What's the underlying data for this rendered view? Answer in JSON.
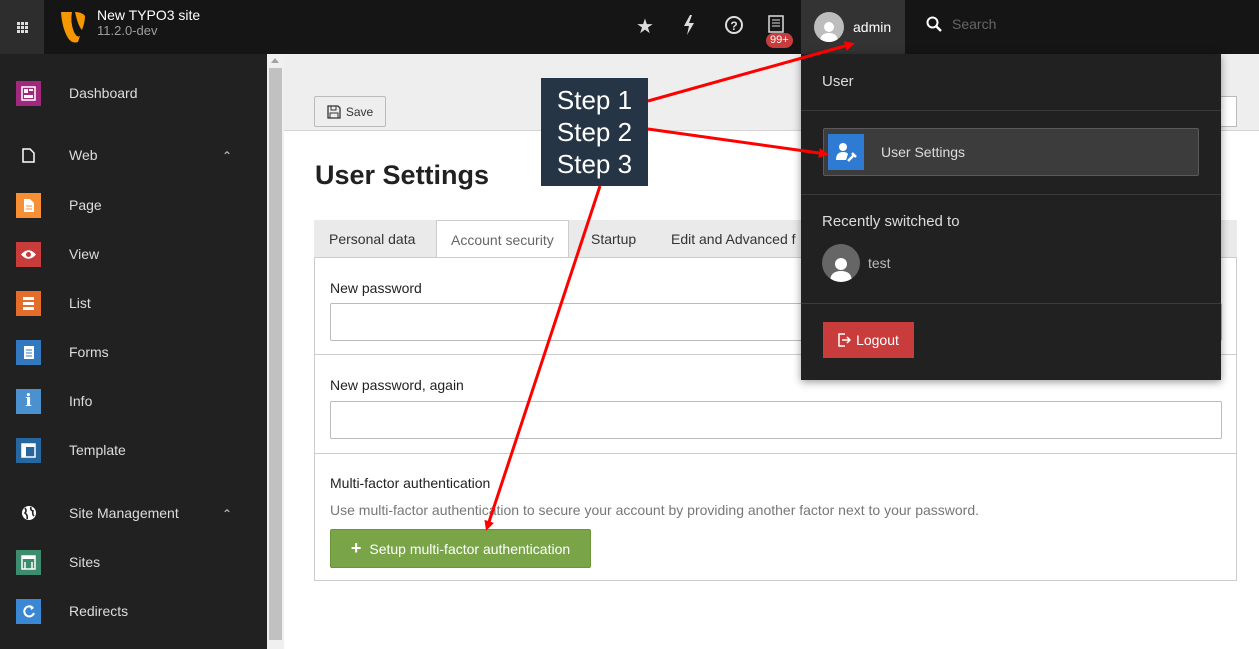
{
  "topbar": {
    "site_name": "New TYPO3 site",
    "version": "11.2.0-dev",
    "notification_badge": "99+",
    "username": "admin",
    "search_placeholder": "Search",
    "icons": [
      "apps-grid-icon",
      "typo3-logo",
      "star-icon",
      "flash-icon",
      "help-icon",
      "system-info-icon",
      "user-avatar-icon",
      "search-icon"
    ]
  },
  "sidebar": {
    "items": [
      {
        "label": "Dashboard",
        "icon": "dashboard-icon",
        "color": "#a0287d"
      },
      {
        "label": "Web",
        "icon": "page-outline-icon",
        "group": true
      },
      {
        "label": "Page",
        "icon": "page-icon",
        "color": "#f78f34"
      },
      {
        "label": "View",
        "icon": "eye-icon",
        "color": "#c83c3c"
      },
      {
        "label": "List",
        "icon": "list-icon",
        "color": "#e46d2b"
      },
      {
        "label": "Forms",
        "icon": "forms-icon",
        "color": "#3379c0"
      },
      {
        "label": "Info",
        "icon": "info-icon",
        "color": "#4b91cf"
      },
      {
        "label": "Template",
        "icon": "template-icon",
        "color": "#25679e"
      },
      {
        "label": "Site Management",
        "icon": "globe-icon",
        "group": true
      },
      {
        "label": "Sites",
        "icon": "sites-icon",
        "color": "#3d8c6e"
      },
      {
        "label": "Redirects",
        "icon": "redirect-icon",
        "color": "#3a87d3"
      }
    ]
  },
  "toolbar": {
    "save_label": "Save"
  },
  "main": {
    "title": "User Settings",
    "tabs": [
      {
        "label": "Personal data",
        "active": false
      },
      {
        "label": "Account security",
        "active": true
      },
      {
        "label": "Startup",
        "active": false
      },
      {
        "label": "Edit and Advanced f",
        "active": false
      }
    ],
    "new_password_label": "New password",
    "new_password_again_label": "New password, again",
    "mfa_title": "Multi-factor authentication",
    "mfa_description": "Use multi-factor authentication to secure your account by providing another factor next to your password.",
    "mfa_button": "Setup multi-factor authentication"
  },
  "user_menu": {
    "header": "User",
    "settings_item": "User Settings",
    "recent_header": "Recently switched to",
    "recent_user": "test",
    "logout": "Logout"
  },
  "annotation": {
    "step1": "Step 1",
    "step2": "Step 2",
    "step3": "Step 3",
    "arrow_color": "#ff0000"
  },
  "colors": {
    "topbar_bg": "#151515",
    "sidebar_bg": "#212121",
    "accent_green": "#79a548",
    "danger_red": "#c83c3c",
    "user_settings_icon_bg": "#2f7bd4"
  }
}
